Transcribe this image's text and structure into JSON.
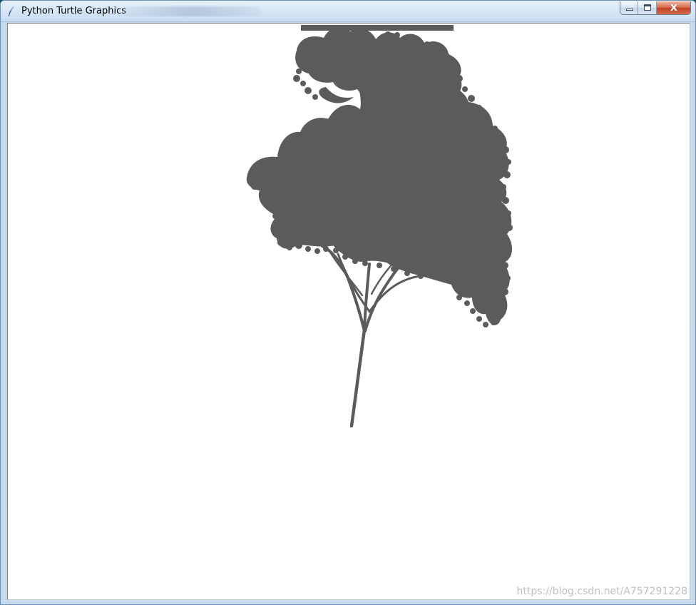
{
  "window": {
    "title": "Python Turtle Graphics",
    "controls": {
      "minimize": "",
      "maximize": "",
      "close": "x"
    }
  },
  "canvas": {
    "drawing": "fractal tree",
    "fill_color": "#5b5b5b",
    "background": "#ffffff"
  },
  "watermark": {
    "text": "https://blog.csdn.net/A757291228"
  },
  "icons": {
    "app_icon": "feather-icon",
    "minimize_icon": "minimize-icon",
    "maximize_icon": "maximize-icon",
    "close_icon": "close-icon"
  }
}
